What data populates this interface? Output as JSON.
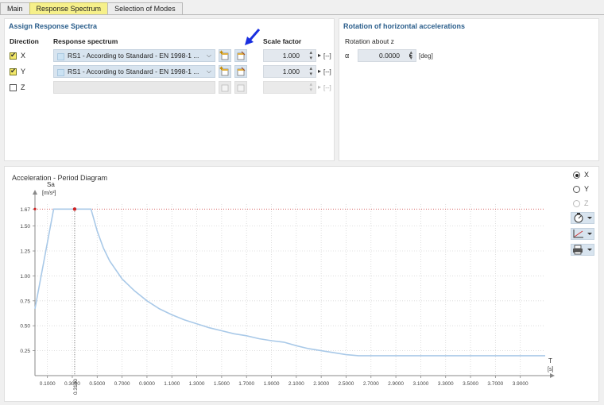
{
  "tabs": [
    "Main",
    "Response Spectrum",
    "Selection of Modes"
  ],
  "active_tab": 1,
  "assign": {
    "title": "Assign Response Spectra",
    "col_direction": "Direction",
    "col_spectrum": "Response spectrum",
    "col_scale": "Scale factor",
    "rows": [
      {
        "dir": "X",
        "checked": true,
        "spectrum": "RS1 - According to Standard - EN 1998-1 ...",
        "scale": "1.000",
        "unit": "[--]"
      },
      {
        "dir": "Y",
        "checked": true,
        "spectrum": "RS1 - According to Standard - EN 1998-1 ...",
        "scale": "1.000",
        "unit": "[--]"
      },
      {
        "dir": "Z",
        "checked": false,
        "spectrum": "",
        "scale": "",
        "unit": "[--]"
      }
    ]
  },
  "rotation": {
    "title": "Rotation of horizontal accelerations",
    "about": "Rotation about z",
    "symbol": "α",
    "value": "0.0000",
    "unit": "[deg]"
  },
  "diagram_panel": {
    "title": "Acceleration - Period Diagram",
    "radios": [
      {
        "label": "X",
        "selected": true,
        "disabled": false
      },
      {
        "label": "Y",
        "selected": false,
        "disabled": false
      },
      {
        "label": "Z",
        "selected": false,
        "disabled": true
      }
    ],
    "tool_icons": [
      "gauge-icon",
      "axis-icon",
      "print-icon"
    ]
  },
  "chart_data": {
    "type": "line",
    "title": "",
    "ylabel_main": "Sa",
    "ylabel_unit": "[m/s²]",
    "xlabel": "T",
    "xunit": "[s]",
    "xlim": [
      0,
      4.1
    ],
    "ylim": [
      0,
      1.72
    ],
    "y_ticks": [
      "0.25",
      "0.50",
      "0.75",
      "1.00",
      "1.25",
      "1.50",
      "1.67"
    ],
    "x_ticks": [
      "0.1000",
      "0.3000",
      "0.5000",
      "0.7000",
      "0.9000",
      "1.1000",
      "1.3000",
      "1.5000",
      "1.7000",
      "1.9000",
      "2.1000",
      "2.3000",
      "2.5000",
      "2.7000",
      "2.9000",
      "3.1000",
      "3.3000",
      "3.5000",
      "3.7000",
      "3.9000"
    ],
    "marker_x_label": "0.3190",
    "marker_point": [
      0.319,
      1.67
    ],
    "color": "#a9c9e8",
    "series": [
      {
        "points": [
          [
            0,
            0.67
          ],
          [
            0.15,
            1.67
          ],
          [
            0.45,
            1.67
          ],
          [
            0.5,
            1.45
          ],
          [
            0.55,
            1.28
          ],
          [
            0.6,
            1.15
          ],
          [
            0.7,
            0.97
          ],
          [
            0.8,
            0.85
          ],
          [
            0.9,
            0.75
          ],
          [
            1.0,
            0.67
          ],
          [
            1.1,
            0.61
          ],
          [
            1.2,
            0.56
          ],
          [
            1.3,
            0.52
          ],
          [
            1.4,
            0.48
          ],
          [
            1.5,
            0.45
          ],
          [
            1.6,
            0.42
          ],
          [
            1.7,
            0.4
          ],
          [
            1.8,
            0.37
          ],
          [
            1.9,
            0.35
          ],
          [
            2.0,
            0.335
          ],
          [
            2.1,
            0.3
          ],
          [
            2.2,
            0.27
          ],
          [
            2.3,
            0.25
          ],
          [
            2.4,
            0.23
          ],
          [
            2.5,
            0.21
          ],
          [
            2.6,
            0.2
          ],
          [
            4.1,
            0.2
          ]
        ]
      }
    ]
  }
}
